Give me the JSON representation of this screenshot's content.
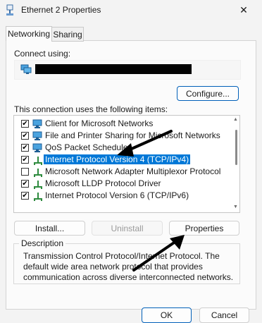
{
  "window": {
    "title": "Ethernet 2 Properties",
    "close_glyph": "✕"
  },
  "tabs": [
    {
      "label": "Networking",
      "active": true
    },
    {
      "label": "Sharing",
      "active": false
    }
  ],
  "connect_using": {
    "label": "Connect using:",
    "adapter_icon": "network-adapter-icon",
    "adapter_name_redacted": true,
    "configure_button": "Configure..."
  },
  "items_section": {
    "label": "This connection uses the following items:",
    "items": [
      {
        "label": "Client for Microsoft Networks",
        "checked": true,
        "icon": "network-client-icon",
        "selected": false
      },
      {
        "label": "File and Printer Sharing for Microsoft Networks",
        "checked": true,
        "icon": "network-client-icon",
        "selected": false
      },
      {
        "label": "QoS Packet Scheduler",
        "checked": true,
        "icon": "network-client-icon",
        "selected": false
      },
      {
        "label": "Internet Protocol Version 4 (TCP/IPv4)",
        "checked": true,
        "icon": "protocol-icon",
        "selected": true
      },
      {
        "label": "Microsoft Network Adapter Multiplexor Protocol",
        "checked": false,
        "icon": "protocol-icon",
        "selected": false
      },
      {
        "label": "Microsoft LLDP Protocol Driver",
        "checked": true,
        "icon": "protocol-icon",
        "selected": false
      },
      {
        "label": "Internet Protocol Version 6 (TCP/IPv6)",
        "checked": true,
        "icon": "protocol-icon",
        "selected": false
      }
    ]
  },
  "item_buttons": {
    "install": "Install...",
    "uninstall": "Uninstall",
    "properties": "Properties"
  },
  "description": {
    "title": "Description",
    "text": "Transmission Control Protocol/Internet Protocol. The default wide area network protocol that provides communication across diverse interconnected networks."
  },
  "dialog_buttons": {
    "ok": "OK",
    "cancel": "Cancel"
  },
  "colors": {
    "accent": "#005fb8",
    "selection": "#0078d7",
    "annotation_arrow": "#000000"
  }
}
